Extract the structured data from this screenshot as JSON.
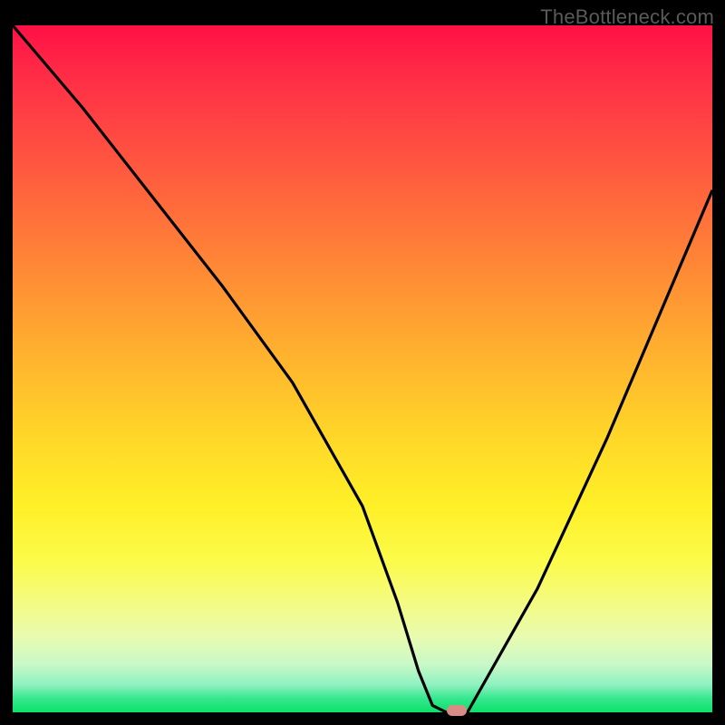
{
  "watermark": "TheBottleneck.com",
  "chart_data": {
    "type": "line",
    "title": "",
    "xlabel": "",
    "ylabel": "",
    "xlim": [
      0,
      100
    ],
    "ylim": [
      0,
      100
    ],
    "grid": false,
    "series": [
      {
        "name": "curve",
        "x": [
          0,
          10,
          20,
          30,
          40,
          50,
          55,
          58,
          60,
          62,
          65,
          75,
          85,
          95,
          100
        ],
        "y": [
          100,
          88,
          75,
          62,
          48,
          30,
          16,
          6,
          1,
          0,
          0,
          18,
          40,
          64,
          76
        ]
      }
    ],
    "marker": {
      "x": 63.5,
      "y": 0
    },
    "background_gradient": {
      "top_color": "#ff1046",
      "mid_color": "#ffd728",
      "bottom_color": "#0be268"
    }
  }
}
